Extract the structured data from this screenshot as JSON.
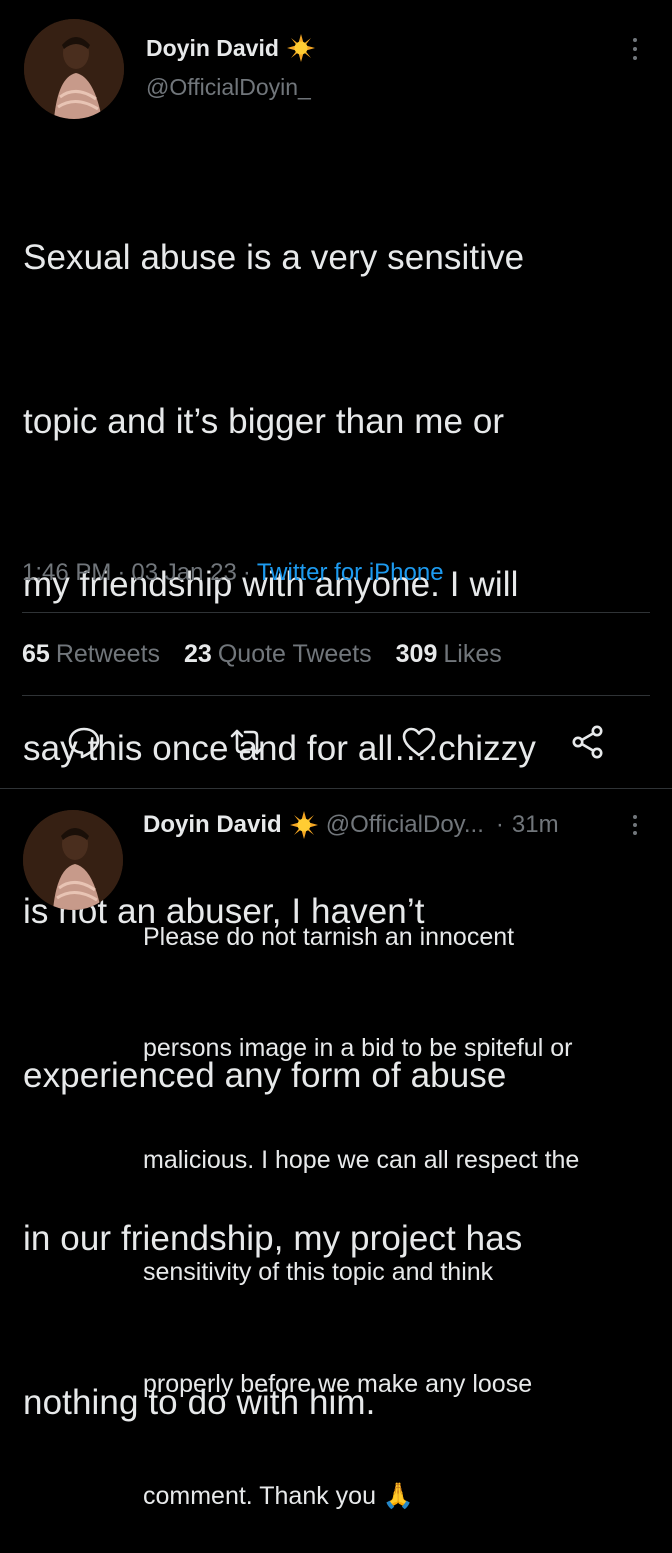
{
  "tweet": {
    "display_name": "Doyin David",
    "handle": "@OfficialDoyin_",
    "verified_icon": "sun-emoji-icon",
    "more_icon": "more-vertical-icon",
    "text_lines": [
      "Sexual abuse is a very sensitive",
      "topic and it’s bigger than me or",
      "my friendship with anyone. I will",
      "say this once and for all….chizzy",
      "is not an abuser, I haven’t",
      "experienced any form of abuse",
      "in our friendship, my project has",
      "nothing to do with him."
    ],
    "time": "1:46 PM",
    "separator": "·",
    "date": "03 Jan 23",
    "source": "Twitter for iPhone"
  },
  "stats": {
    "retweets_count": "65",
    "retweets_label": "Retweets",
    "quotes_count": "23",
    "quotes_label": "Quote Tweets",
    "likes_count": "309",
    "likes_label": "Likes"
  },
  "actions": {
    "reply_icon": "reply-icon",
    "retweet_icon": "retweet-icon",
    "like_icon": "like-icon",
    "share_icon": "share-icon"
  },
  "reply": {
    "display_name": "Doyin David",
    "handle": "@OfficialDoy...",
    "separator": "·",
    "time": "31m",
    "text_lines": [
      "Please do not tarnish an innocent",
      "persons image in a bid to be spiteful or",
      "malicious. I hope we can all respect the",
      "sensitivity of this topic and think",
      "properly before we make any loose",
      "comment. Thank you 🙏"
    ],
    "emoji_icon": "folded-hands-icon"
  },
  "colors": {
    "background": "#000000",
    "text": "#e7e9ea",
    "secondary": "#71767b",
    "link": "#1d9bf0",
    "divider": "#2f3336"
  }
}
